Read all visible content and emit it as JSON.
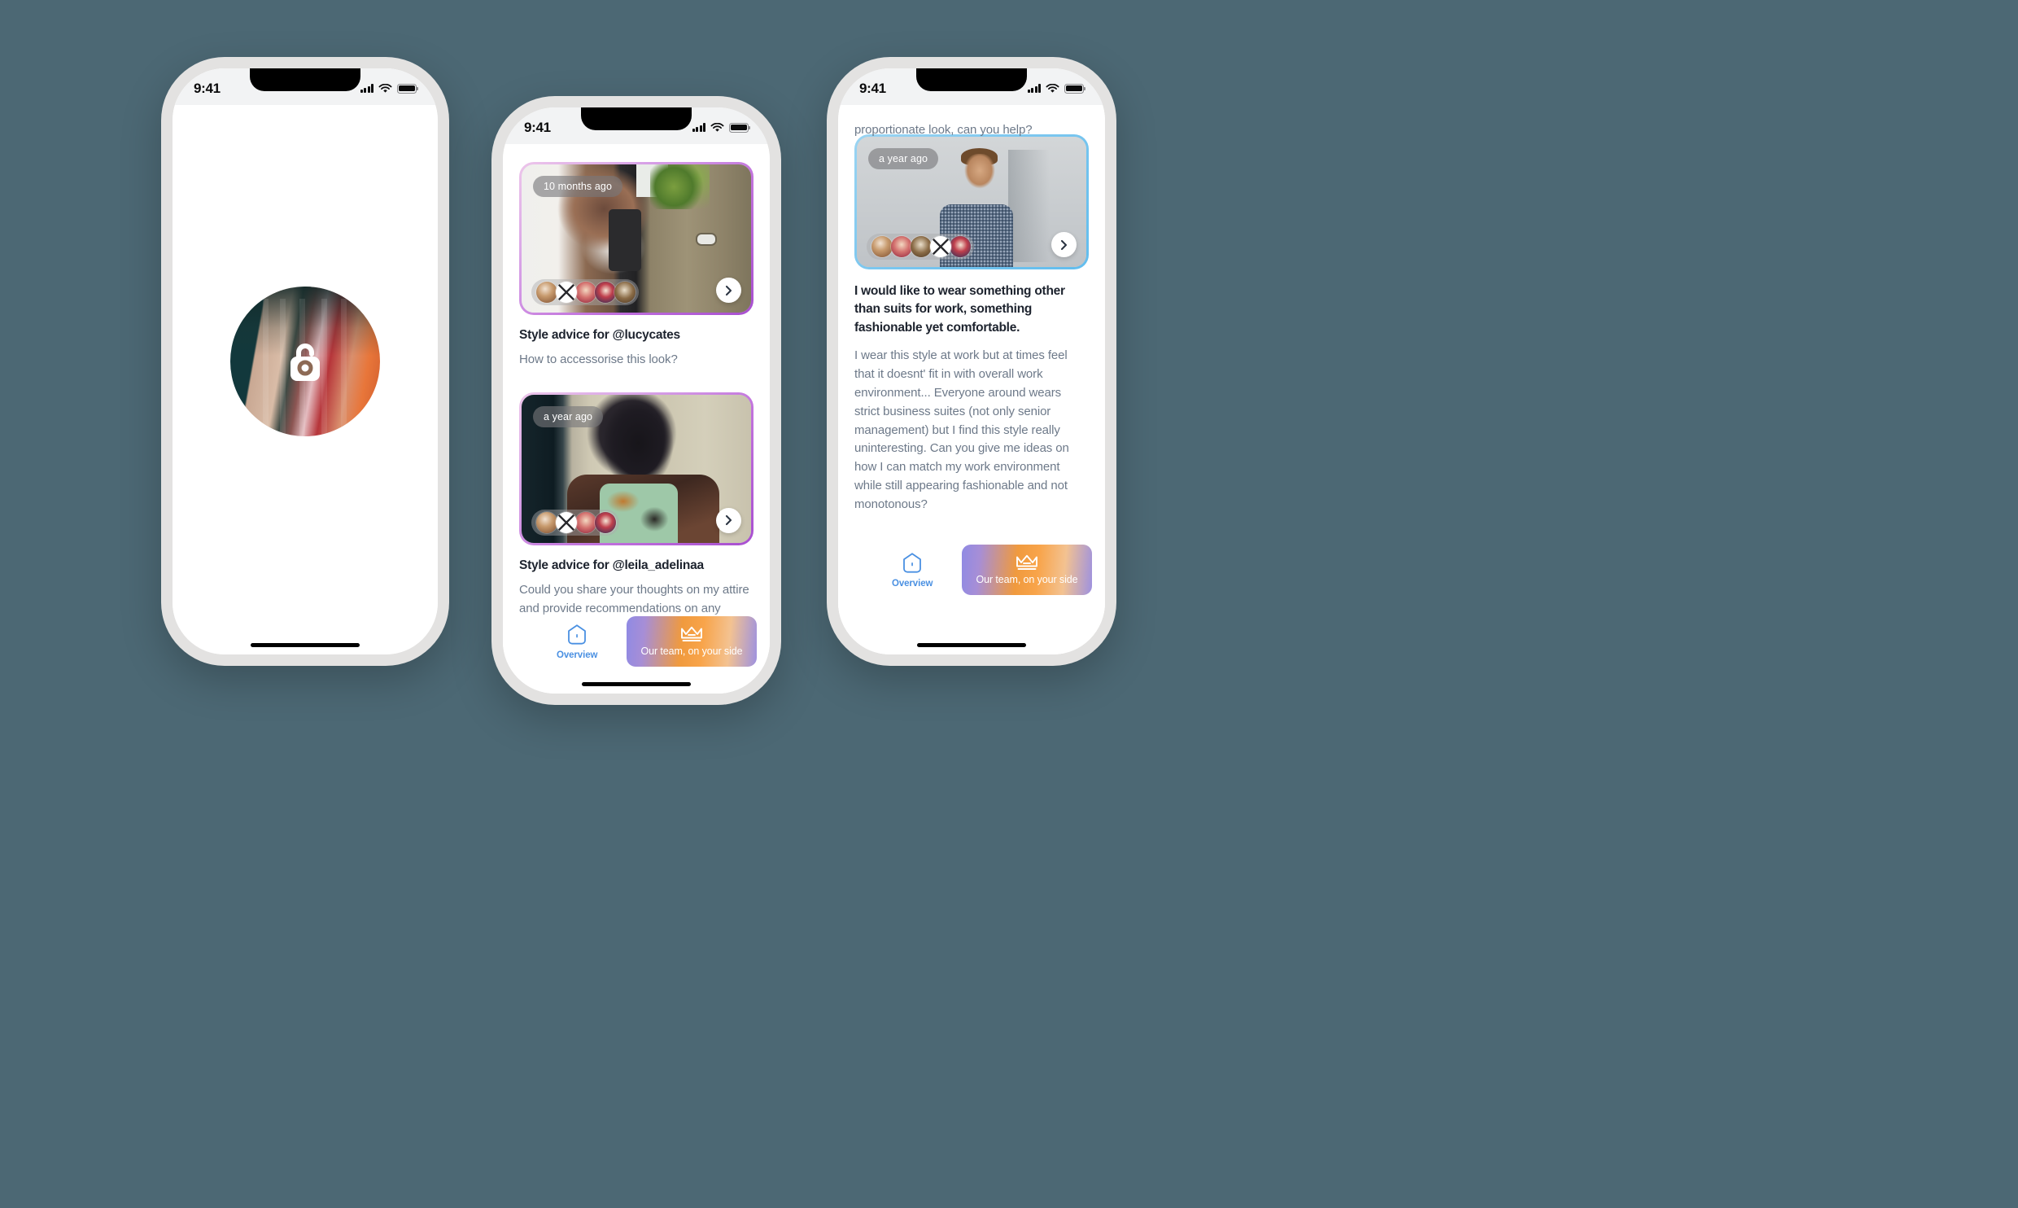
{
  "background_color": "#4c6874",
  "status_bar": {
    "time": "9:41",
    "signal_icon": "cellular-signal-icon",
    "wifi_icon": "wifi-icon",
    "battery_icon": "battery-icon"
  },
  "phone1": {
    "name": "splash-screen",
    "logo_icon": "padlock-logo-icon",
    "logo_photo": "clothing-rack-photo"
  },
  "phone2": {
    "name": "feed-screen",
    "posts": [
      {
        "time_chip": "10 months ago",
        "title": "Style advice for @lucycates",
        "body": "How to accessorise this look?",
        "photo": "woman-mirror-selfie-photo",
        "ring_color": "#b060d8",
        "next_icon": "chevron-right-icon",
        "avatars": [
          "avatar-1",
          "avatar-2",
          "avatar-3",
          "avatar-4",
          "avatar-5"
        ]
      },
      {
        "time_chip": "a year ago",
        "title": "Style advice for @leila_adelinaa",
        "body": "Could you share your thoughts on my attire and provide recommendations on any",
        "photo": "woman-sunglasses-leather-jacket-photo",
        "ring_color": "#b060d8",
        "next_icon": "chevron-right-icon",
        "avatars": [
          "avatar-1",
          "avatar-2",
          "avatar-3",
          "avatar-4"
        ]
      }
    ]
  },
  "phone3": {
    "name": "question-detail-screen",
    "partial_text_above": "proportionate look, can you help?",
    "time_chip": "a year ago",
    "photo": "man-checkered-shirt-photo",
    "ring_color": "#7cc7ef",
    "next_icon": "chevron-right-icon",
    "avatars": [
      "avatar-1",
      "avatar-2",
      "avatar-3",
      "avatar-4",
      "avatar-5"
    ],
    "question_heading": "I would like to wear something other than suits for work, something fashionable yet comfortable.",
    "question_body": "I wear this style at work but at times feel that it doesnt' fit in with overall work environment... Everyone around wears strict business suites (not only senior management) but I find this style really uninteresting. Can you give me ideas on how I can match my work environment while still appearing fashionable and not monotonous?"
  },
  "bottom_bar": {
    "overview_label": "Overview",
    "overview_icon": "home-pentagon-icon",
    "overview_color": "#4a90e2",
    "cta_label": "Our team, on your side",
    "cta_icon": "crown-icon",
    "cta_gradient_start": "#8f8ae4",
    "cta_gradient_mid": "#f09a3e",
    "cta_gradient_end": "#9d91e0"
  }
}
